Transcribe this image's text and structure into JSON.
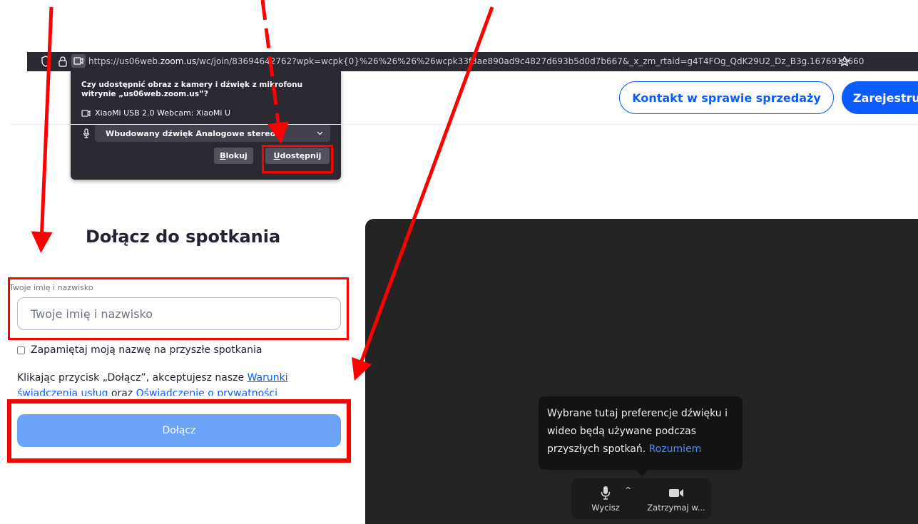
{
  "browser": {
    "url_prefix": "https://us06web.",
    "url_domain": "zoom.us",
    "url_rest": "/wc/join/83694642762?wpk=wcpk{0}%26%26%26%26wcpk33f3ae890ad9c4827d693b5d0d7b667&_x_zm_rtaid=g4T4FOg_QdK29U2_Dz_B3g.1676919660"
  },
  "permission": {
    "question": "Czy udostępnić obraz z kamery i dźwięk z mikrofonu witrynie „us06web.zoom.us”?",
    "camera_device": "XiaoMi USB 2.0 Webcam: XiaoMi U",
    "microphone_device": "Wbudowany dźwięk Analogowe stereo",
    "block_first": "B",
    "block_rest": "lokuj",
    "share_first": "U",
    "share_rest": "dostępnij"
  },
  "header": {
    "contact_label": "Kontakt w sprawie sprzedaży",
    "register_label": "Zarejestruj"
  },
  "join": {
    "title": "Dołącz do spotkania",
    "name_label": "Twoje imię i nazwisko",
    "name_placeholder": "Twoje imię i nazwisko",
    "name_value": "",
    "remember_label": "Zapamiętaj moją nazwę na przyszłe spotkania",
    "remember_checked": false,
    "terms_prefix": "Klikając przycisk „Dołącz”, akceptujesz nasze ",
    "terms_link": "Warunki świadczenia usług",
    "terms_middle": " oraz ",
    "privacy_link": "Oświadczenie o prywatności",
    "join_label": "Dołącz"
  },
  "preview": {
    "tip_text": "Wybrane tutaj preferencje dźwięku i wideo będą używane podczas przyszłych spotkań.",
    "tip_link": "Rozumiem",
    "mute_label": "Wycisz",
    "stop_video_label": "Zatrzymaj w..."
  },
  "colors": {
    "accent": "#0b5cff",
    "join_disabled": "#6aa3f8",
    "annotation": "#ff0000"
  }
}
